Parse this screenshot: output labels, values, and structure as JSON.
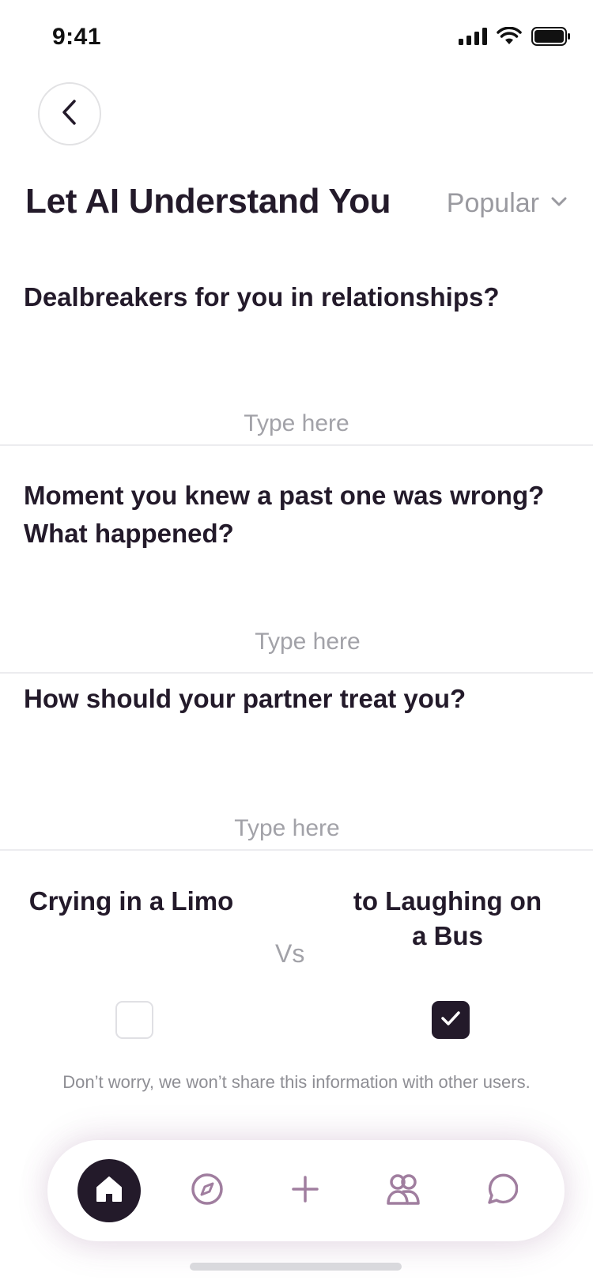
{
  "status_bar": {
    "time": "9:41"
  },
  "header": {
    "title": "Let AI Understand You",
    "sort_label": "Popular"
  },
  "questions": [
    {
      "text": "Dealbreakers for you in relationships?",
      "placeholder": "Type here"
    },
    {
      "text": "Moment you knew a past one was wrong? What happened?",
      "placeholder": "Type here"
    },
    {
      "text": "How should your partner treat you?",
      "placeholder": "Type here"
    }
  ],
  "versus": {
    "left_label": "Crying in a Limo",
    "right_label": "to Laughing on a Bus",
    "vs": "Vs",
    "left_checked": false,
    "right_checked": true
  },
  "privacy_note": "Don’t worry, we won’t share this information with other users.",
  "bottom_nav": [
    {
      "icon": "home-icon",
      "active": true
    },
    {
      "icon": "compass-icon",
      "active": false
    },
    {
      "icon": "plus-icon",
      "active": false
    },
    {
      "icon": "people-icon",
      "active": false
    },
    {
      "icon": "chat-icon",
      "active": false
    }
  ],
  "colors": {
    "primary_dark": "#231a2a",
    "muted_text": "#a2a2a8",
    "nav_icon": "#a07e9f"
  }
}
